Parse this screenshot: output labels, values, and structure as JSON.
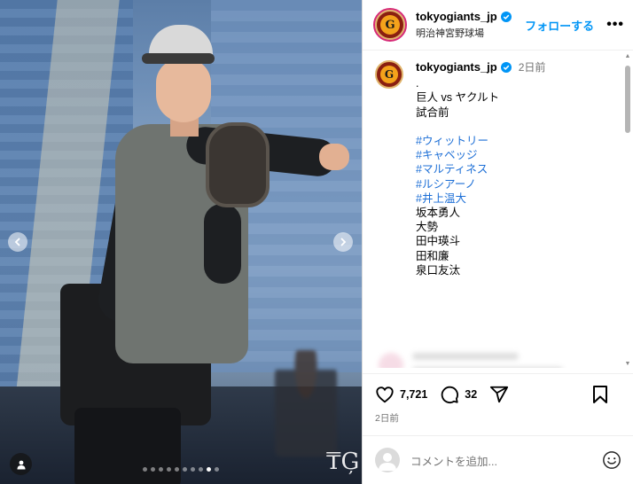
{
  "post": {
    "username": "tokyogiants_jp",
    "location": "明治神宮野球場",
    "follow_label": "フォローする",
    "more_label": "•••",
    "avatar_letter": "G"
  },
  "caption": {
    "username": "tokyogiants_jp",
    "time": "2日前",
    "lines": [
      {
        "text": ".",
        "hashtag": false
      },
      {
        "text": "巨人 vs ヤクルト",
        "hashtag": false
      },
      {
        "text": "試合前",
        "hashtag": false
      },
      {
        "text": "",
        "hashtag": false
      },
      {
        "text": "#ウィットリー",
        "hashtag": true
      },
      {
        "text": "#キャベッジ",
        "hashtag": true
      },
      {
        "text": "#マルティネス",
        "hashtag": true
      },
      {
        "text": "#ルシアーノ",
        "hashtag": true
      },
      {
        "text": "#井上温大",
        "hashtag": true
      },
      {
        "text": "坂本勇人",
        "hashtag": false
      },
      {
        "text": "大勢",
        "hashtag": false
      },
      {
        "text": "田中瑛斗",
        "hashtag": false
      },
      {
        "text": "田和廉",
        "hashtag": false
      },
      {
        "text": "泉口友汰",
        "hashtag": false
      }
    ]
  },
  "actions": {
    "likes": "7,721",
    "comments": "32",
    "date": "2日前"
  },
  "comment_box": {
    "placeholder": "コメントを追加..."
  },
  "carousel": {
    "total_slides": 10,
    "active_index": 8,
    "watermark": "TG"
  },
  "colors": {
    "link": "#0095f6",
    "hashtag": "#1d6fd6",
    "muted": "#737373",
    "border": "#dbdbdb"
  },
  "icons": {
    "like": "heart-icon",
    "comment": "comment-icon",
    "share": "share-icon",
    "save": "bookmark-icon",
    "emoji": "emoji-icon",
    "verified": "verified-badge-icon",
    "prev": "chevron-left-icon",
    "next": "chevron-right-icon",
    "tag": "user-tag-icon"
  }
}
